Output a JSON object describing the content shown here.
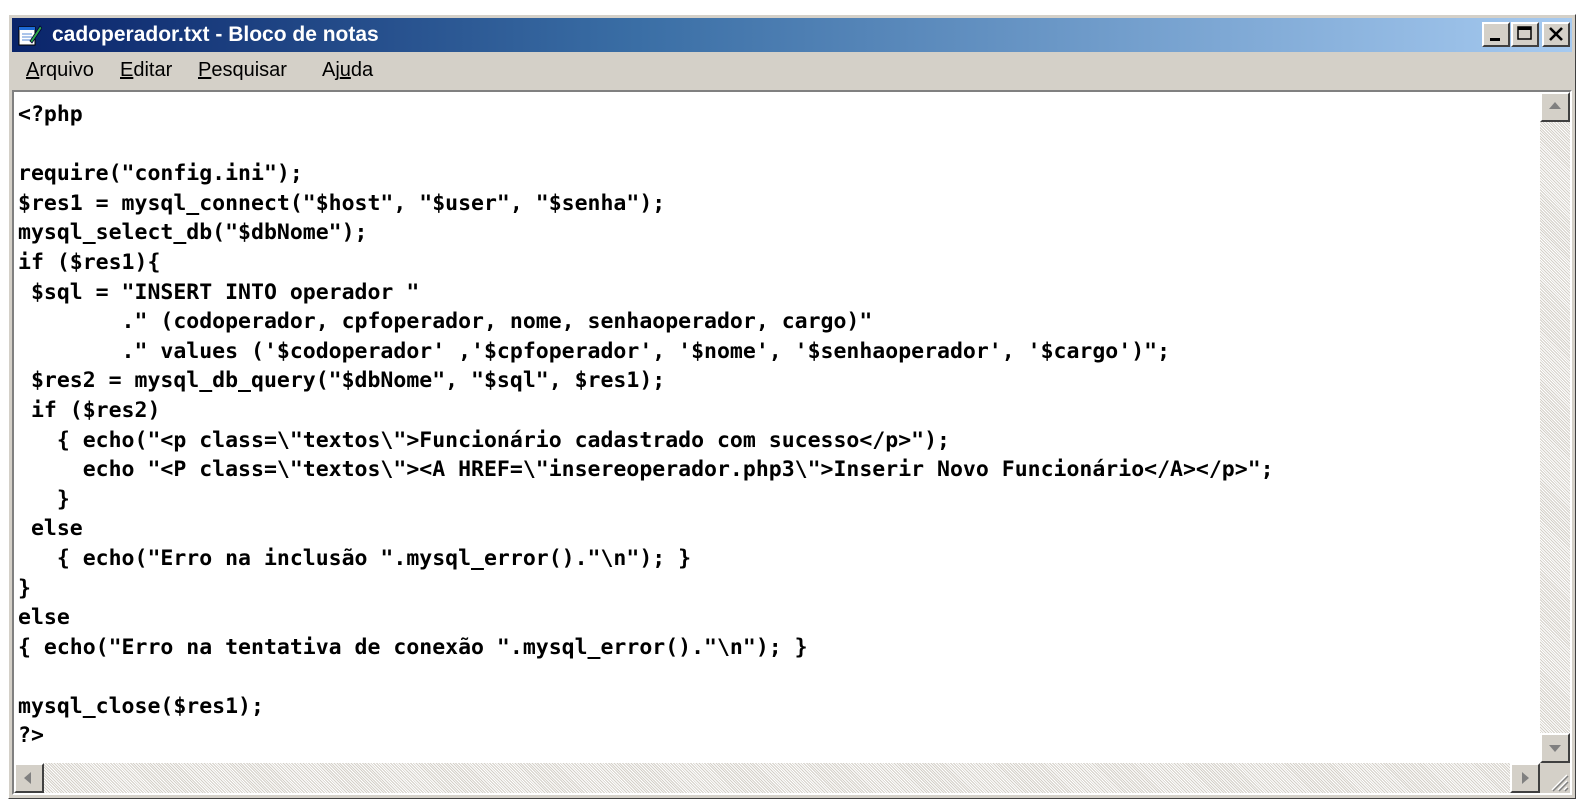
{
  "window": {
    "title": "cadoperador.txt - Bloco de notas"
  },
  "menu": [
    {
      "label": "Arquivo",
      "key": "A",
      "rest": "rquivo"
    },
    {
      "label": "Editar",
      "key": "E",
      "rest": "ditar"
    },
    {
      "label": "Pesquisar",
      "key": "P",
      "rest": "esquisar"
    },
    {
      "label": "Ajuda",
      "pre": "Aj",
      "key": "u",
      "rest": "da"
    }
  ],
  "editor": {
    "lines": [
      "<?php",
      "",
      "require(\"config.ini\");",
      "$res1 = mysql_connect(\"$host\", \"$user\", \"$senha\");",
      "mysql_select_db(\"$dbNome\");",
      "if ($res1){",
      " $sql = \"INSERT INTO operador \"",
      "        .\" (codoperador, cpfoperador, nome, senhaoperador, cargo)\"",
      "        .\" values ('$codoperador' ,'$cpfoperador', '$nome', '$senhaoperador', '$cargo')\";",
      " $res2 = mysql_db_query(\"$dbNome\", \"$sql\", $res1);",
      " if ($res2)",
      "   { echo(\"<p class=\\\"textos\\\">Funcionário cadastrado com sucesso</p>\");",
      "     echo \"<P class=\\\"textos\\\"><A HREF=\\\"insereoperador.php3\\\">Inserir Novo Funcionário</A></p>\";",
      "   }",
      " else",
      "   { echo(\"Erro na inclusão \".mysql_error().\"\\n\"); }",
      "}",
      "else",
      "{ echo(\"Erro na tentativa de conexão \".mysql_error().\"\\n\"); }",
      "",
      "mysql_close($res1);",
      "?>"
    ]
  },
  "icons": {
    "app": "notepad-icon",
    "minimize": "minimize-icon",
    "maximize": "maximize-icon",
    "close": "close-icon"
  },
  "colors": {
    "titlebar_start": "#0a246a",
    "titlebar_end": "#a6caf0",
    "face": "#d4d0c8"
  }
}
